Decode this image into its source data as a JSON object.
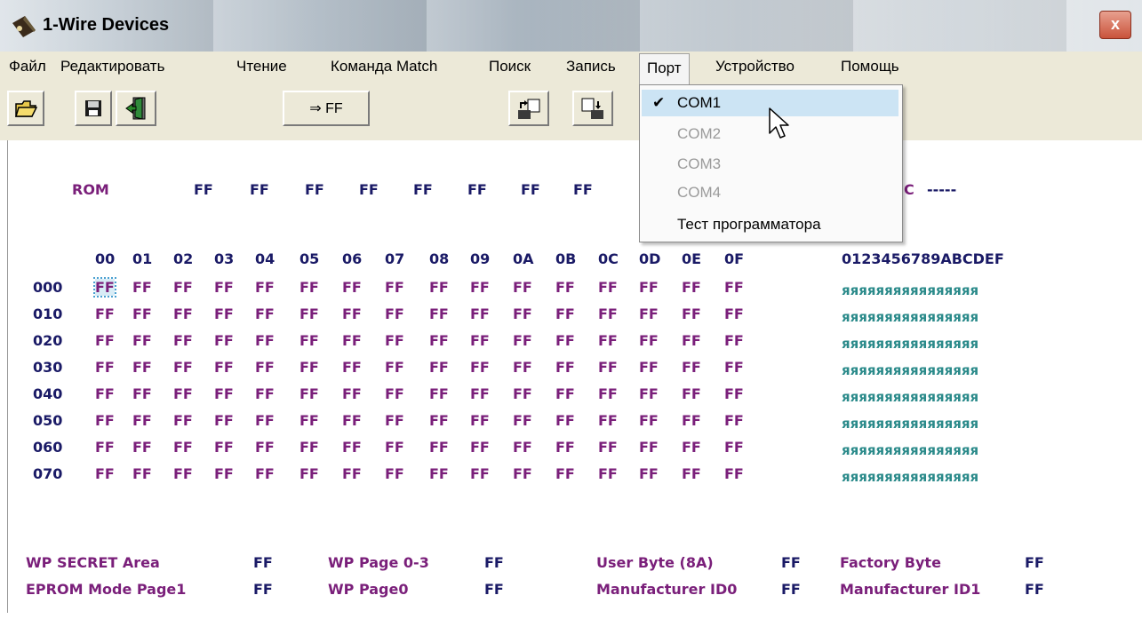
{
  "window": {
    "title": "1-Wire Devices",
    "close_label": "x"
  },
  "menubar": {
    "items": [
      "Файл",
      "Редактировать",
      "Чтение",
      "Команда Match",
      "Поиск",
      "Запись",
      "Порт",
      "Устройство",
      "Помощь"
    ]
  },
  "toolbar": {
    "fill_label": "⇒ FF",
    "icons": [
      "open-folder-icon",
      "save-disk-icon",
      "exit-door-icon",
      "read-device-icon",
      "write-device-icon"
    ]
  },
  "port_menu": {
    "items": [
      {
        "label": "COM1",
        "checked": true,
        "enabled": true
      },
      {
        "label": "COM2",
        "checked": false,
        "enabled": false
      },
      {
        "label": "COM3",
        "checked": false,
        "enabled": false
      },
      {
        "label": "COM4",
        "checked": false,
        "enabled": false
      },
      {
        "label": "Тест программатора",
        "checked": false,
        "enabled": true
      }
    ]
  },
  "rom": {
    "label": "ROM",
    "bytes": [
      "FF",
      "FF",
      "FF",
      "FF",
      "FF",
      "FF",
      "FF",
      "FF"
    ],
    "crc_partial": "C",
    "crc_value": "-----"
  },
  "hex_dump": {
    "columns": [
      "00",
      "01",
      "02",
      "03",
      "04",
      "05",
      "06",
      "07",
      "08",
      "09",
      "0A",
      "0B",
      "0C",
      "0D",
      "0E",
      "0F"
    ],
    "ascii_header": "0123456789ABCDEF",
    "rows": [
      {
        "addr": "000",
        "ascii": "яяяяяяяяяяяяяяяя"
      },
      {
        "addr": "010",
        "ascii": "яяяяяяяяяяяяяяяя"
      },
      {
        "addr": "020",
        "ascii": "яяяяяяяяяяяяяяяя"
      },
      {
        "addr": "030",
        "ascii": "яяяяяяяяяяяяяяяя"
      },
      {
        "addr": "040",
        "ascii": "яяяяяяяяяяяяяяяя"
      },
      {
        "addr": "050",
        "ascii": "яяяяяяяяяяяяяяяя"
      },
      {
        "addr": "060",
        "ascii": "яяяяяяяяяяяяяяяя"
      },
      {
        "addr": "070",
        "ascii": "яяяяяяяяяяяяяяяя"
      }
    ],
    "byte_value": "FF"
  },
  "status": {
    "wp_secret_label": "WP SECRET Area",
    "wp_secret_value": "FF",
    "eprom_mode_label": "EPROM Mode Page1",
    "eprom_mode_value": "FF",
    "wp_page03_label": "WP Page 0-3",
    "wp_page03_value": "FF",
    "wp_page0_label": "WP Page0",
    "wp_page0_value": "FF",
    "user_byte_label": "User Byte (8A)",
    "user_byte_value": "FF",
    "manufacturer_id0_label": "Manufacturer ID0",
    "manufacturer_id0_value": "FF",
    "factory_byte_label": "Factory Byte",
    "factory_byte_value": "FF",
    "manufacturer_id1_label": "Manufacturer ID1",
    "manufacturer_id1_value": "FF"
  },
  "colors": {
    "address": "#1a1a66",
    "bytes": "#7a1f7a",
    "ascii": "#2a8a8a",
    "menu_bg": "#ece9d8",
    "highlight": "#cce4f4"
  }
}
